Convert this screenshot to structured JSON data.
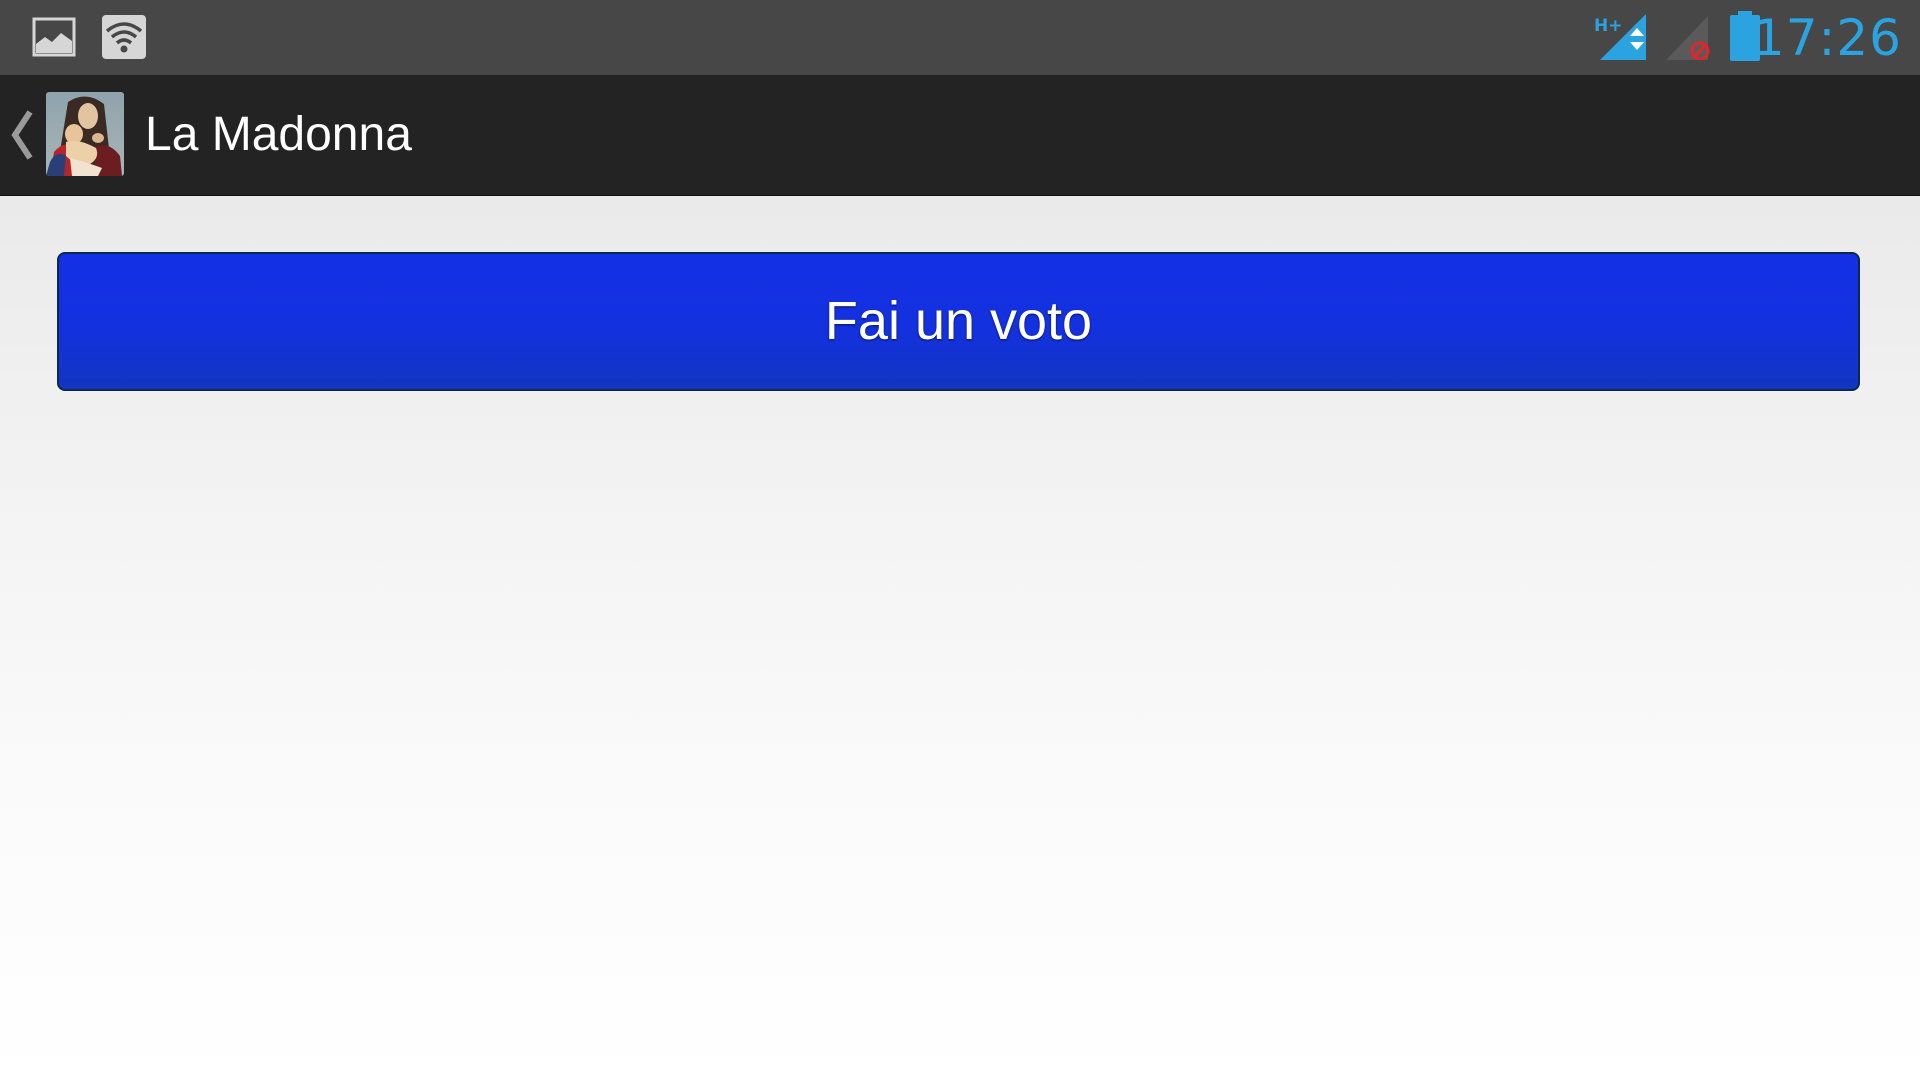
{
  "status_bar": {
    "icons": [
      "gallery-icon",
      "wifi-icon",
      "hplus-signal-icon",
      "no-sim-signal-icon",
      "battery-icon"
    ],
    "time": "17:26",
    "network_label": "H+",
    "accent_color": "#2aa3e0"
  },
  "action_bar": {
    "back_icon": "chevron-left-icon",
    "app_icon": "madonna-app-icon",
    "title": "La Madonna"
  },
  "main": {
    "vote_button_label": "Fai un voto",
    "vote_button_color": "#1431df"
  }
}
